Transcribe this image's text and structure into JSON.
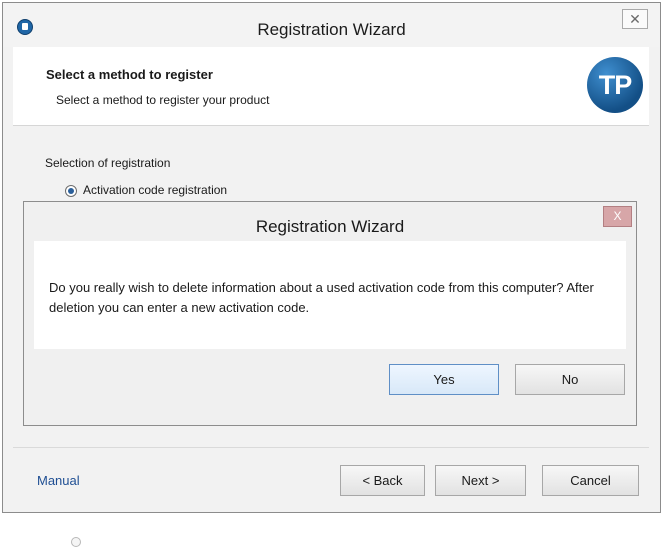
{
  "window": {
    "title": "Registration Wizard",
    "close_label": "✕"
  },
  "header": {
    "title": "Select a method to register",
    "subtitle": "Select a method to register your product",
    "logo_text": "TP"
  },
  "content": {
    "section_label": "Selection of registration",
    "radio_label": "Activation code registration"
  },
  "dialog": {
    "title": "Registration Wizard",
    "close_label": "X",
    "message": "Do you really wish to delete information about a used activation code from this computer? After deletion you can enter a new activation code.",
    "yes_label": "Yes",
    "no_label": "No"
  },
  "footer": {
    "manual_label": "Manual",
    "back_label": "< Back",
    "next_label": "Next >",
    "cancel_label": "Cancel"
  },
  "colors": {
    "accent": "#1f66a6",
    "link": "#1f4f93",
    "dialog_close": "#d7a6a8"
  }
}
